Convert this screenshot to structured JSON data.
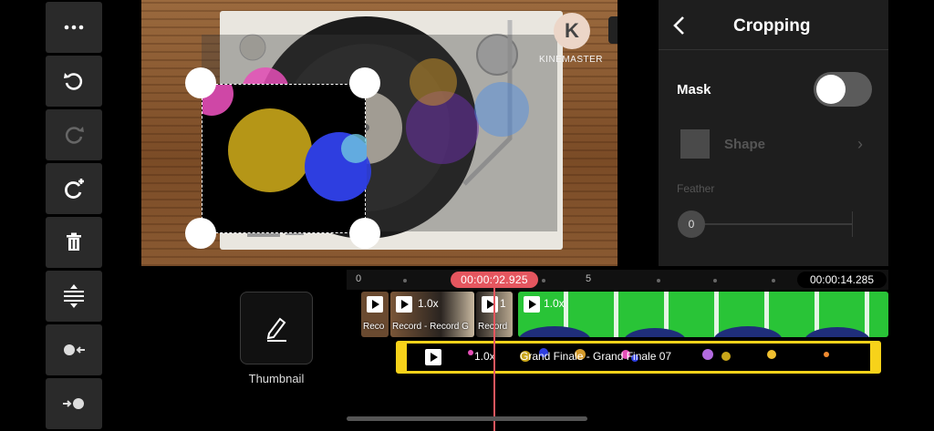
{
  "app": {
    "watermark": "KINEMASTER"
  },
  "toolbar": {
    "items": [
      {
        "icon": "more-icon"
      },
      {
        "icon": "undo-icon"
      },
      {
        "icon": "redo-icon"
      },
      {
        "icon": "add-rotate-icon"
      },
      {
        "icon": "delete-icon"
      },
      {
        "icon": "split-icon"
      },
      {
        "icon": "move-to-playhead-left-icon"
      },
      {
        "icon": "move-to-playhead-right-icon"
      }
    ]
  },
  "panel": {
    "title": "Cropping",
    "mask_label": "Mask",
    "mask_on": false,
    "shape_label": "Shape",
    "feather_label": "Feather",
    "feather_value": "0"
  },
  "thumbnail": {
    "label": "Thumbnail"
  },
  "timeline": {
    "tick_start": "0",
    "tick_mid": "5",
    "current_time": "00:00:02.925",
    "total_time": "00:00:14.285",
    "main_clips": [
      {
        "speed": "",
        "label": "Reco"
      },
      {
        "speed": "1.0x",
        "label": "Record - Record G"
      },
      {
        "speed": "1",
        "label": "Record"
      },
      {
        "speed": "1.0x",
        "label": ""
      }
    ],
    "overlay": {
      "speed": "1.0x",
      "label": "Grand Finale - Grand Finale 07"
    }
  },
  "colors": {
    "accent_red": "#e5565f",
    "overlay_yellow": "#f7d21a",
    "green_screen": "#29c437"
  }
}
